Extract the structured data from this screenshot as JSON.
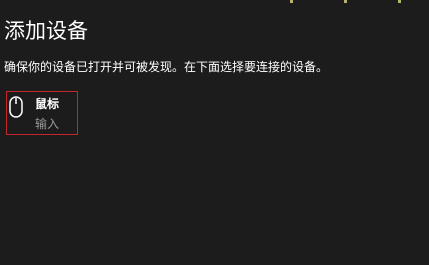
{
  "dialog": {
    "title": "添加设备",
    "description": "确保你的设备已打开并可被发现。在下面选择要连接的设备。"
  },
  "devices": [
    {
      "name": "鼠标",
      "type": "输入",
      "icon": "mouse-icon"
    }
  ],
  "colors": {
    "background": "#1c1c1c",
    "text": "#ffffff",
    "secondary_text": "#9a9a9a",
    "selection_border": "#c4262e"
  }
}
